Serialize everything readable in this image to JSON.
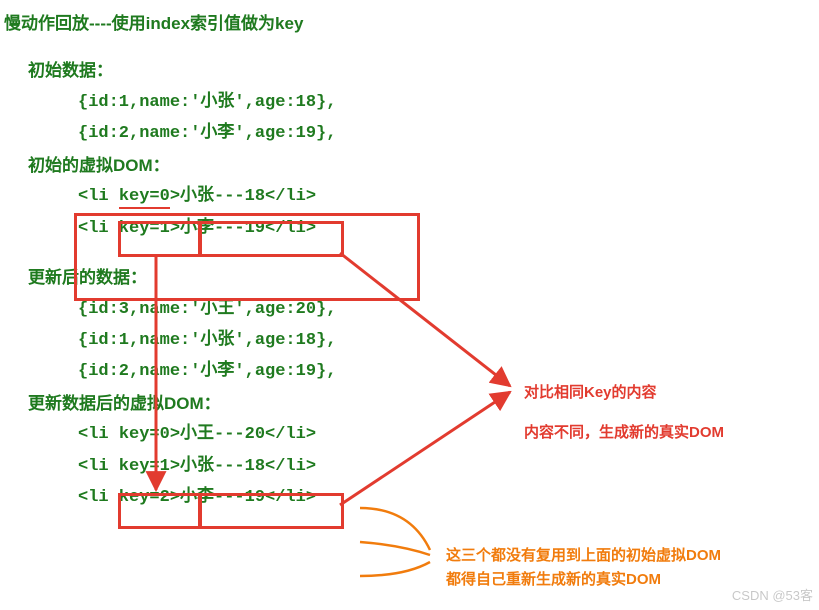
{
  "title": "慢动作回放----使用index索引值做为key",
  "initialData": {
    "heading": "初始数据：",
    "rows": [
      "{id:1,name:'小张',age:18},",
      "{id:2,name:'小李',age:19},"
    ]
  },
  "initialVDOM": {
    "heading": "初始的虚拟DOM：",
    "row0_a": "<li ",
    "row0_key": "key=0",
    "row0_b": ">小张---18</li>",
    "row1": "<li key=1>小李---19</li>"
  },
  "updatedData": {
    "heading": "更新后的数据：",
    "rows": [
      "{id:3,name:'小王',age:20},",
      "{id:1,name:'小张',age:18},",
      "{id:2,name:'小李',age:19},"
    ]
  },
  "updatedVDOM": {
    "heading": "更新数据后的虚拟DOM：",
    "row0_a": "<li ",
    "row0_key": "key=0",
    "row0_b": ">",
    "row0_c": "小王---20</li>",
    "row1": "<li key=1>小张---18</li>",
    "row2": "<li key=2>小李---19</li>"
  },
  "annotation_red_1": "对比相同Key的内容",
  "annotation_red_2": "内容不同，生成新的真实DOM",
  "annotation_orange_1": "这三个都没有复用到上面的初始虚拟DOM",
  "annotation_orange_2": "都得自己重新生成新的真实DOM",
  "watermark": "CSDN @53客",
  "chart_data": {
    "type": "table",
    "note": "Diagram comparing virtual-DOM diff using index as key",
    "initial_list": [
      {
        "id": 1,
        "name": "小张",
        "age": 18
      },
      {
        "id": 2,
        "name": "小李",
        "age": 19
      }
    ],
    "updated_list": [
      {
        "id": 3,
        "name": "小王",
        "age": 20
      },
      {
        "id": 1,
        "name": "小张",
        "age": 18
      },
      {
        "id": 2,
        "name": "小李",
        "age": 19
      }
    ],
    "initial_vdom": [
      {
        "key": 0,
        "text": "小张---18"
      },
      {
        "key": 1,
        "text": "小李---19"
      }
    ],
    "updated_vdom": [
      {
        "key": 0,
        "text": "小王---20"
      },
      {
        "key": 1,
        "text": "小张---18"
      },
      {
        "key": 2,
        "text": "小李---19"
      }
    ],
    "annotations": [
      "对比相同Key的内容 — 内容不同，生成新的真实DOM",
      "这三个都没有复用到上面的初始虚拟DOM 都得自己重新生成新的真实DOM"
    ]
  }
}
